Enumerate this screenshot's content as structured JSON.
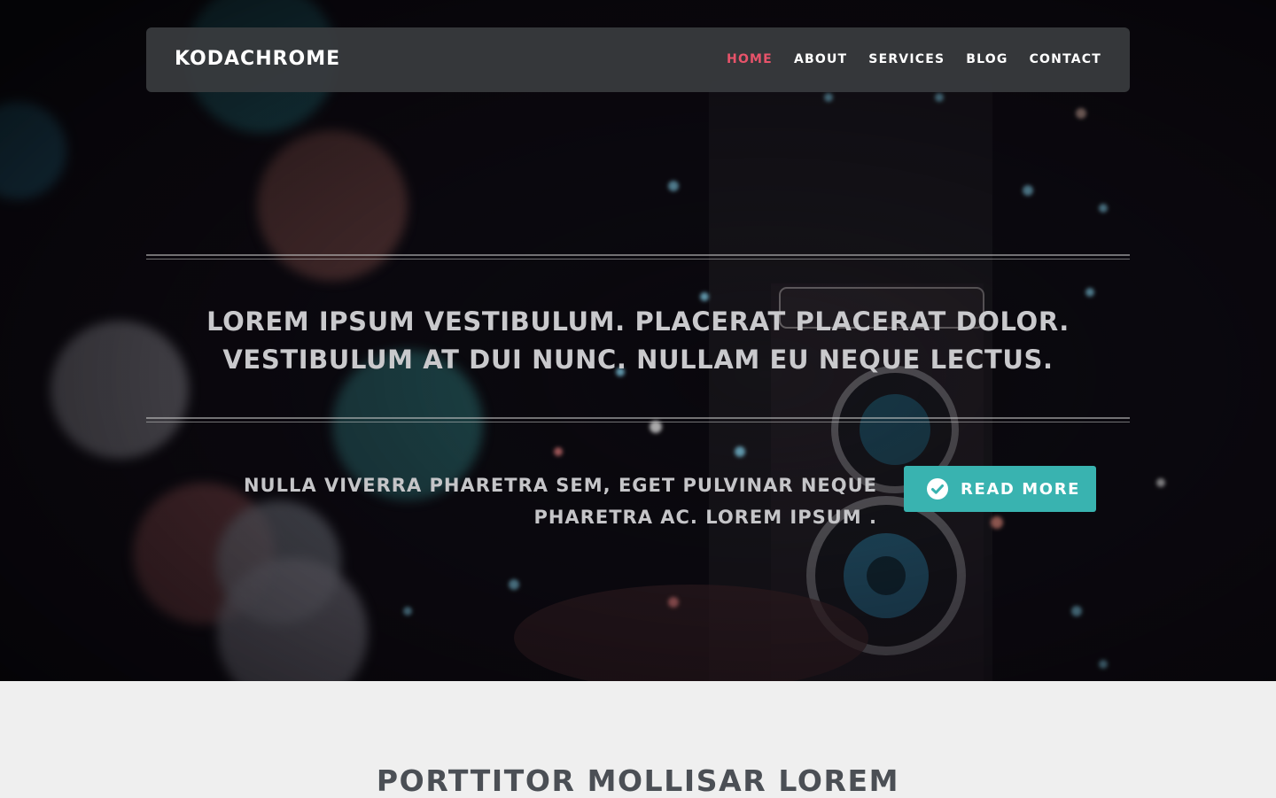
{
  "navbar": {
    "brand": "KODACHROME",
    "links": [
      {
        "label": "HOME",
        "active": true
      },
      {
        "label": "ABOUT",
        "active": false
      },
      {
        "label": "SERVICES",
        "active": false
      },
      {
        "label": "BLOG",
        "active": false
      },
      {
        "label": "CONTACT",
        "active": false
      }
    ]
  },
  "hero": {
    "headline_line1": "LOREM IPSUM VESTIBULUM. PLACERAT PLACERAT DOLOR.",
    "headline_line2": "VESTIBULUM AT DUI NUNC. NULLAM EU NEQUE LECTUS.",
    "sub_line1": "NULLA VIVERRA PHARETRA SEM, EGET PULVINAR NEQUE",
    "sub_line2": "PHARETRA AC. LOREM IPSUM .",
    "button_label": "READ MORE",
    "button_icon": "check-circle-icon",
    "background": "bokeh-camera-photo"
  },
  "section": {
    "title": "PORTTITOR MOLLISAR LOREM"
  },
  "colors": {
    "accent": "#39b3b0",
    "active_nav": "#e8536a",
    "navbar_bg": "#3a3c3f",
    "page_bg": "#efefef",
    "section_title": "#4b4f55"
  }
}
